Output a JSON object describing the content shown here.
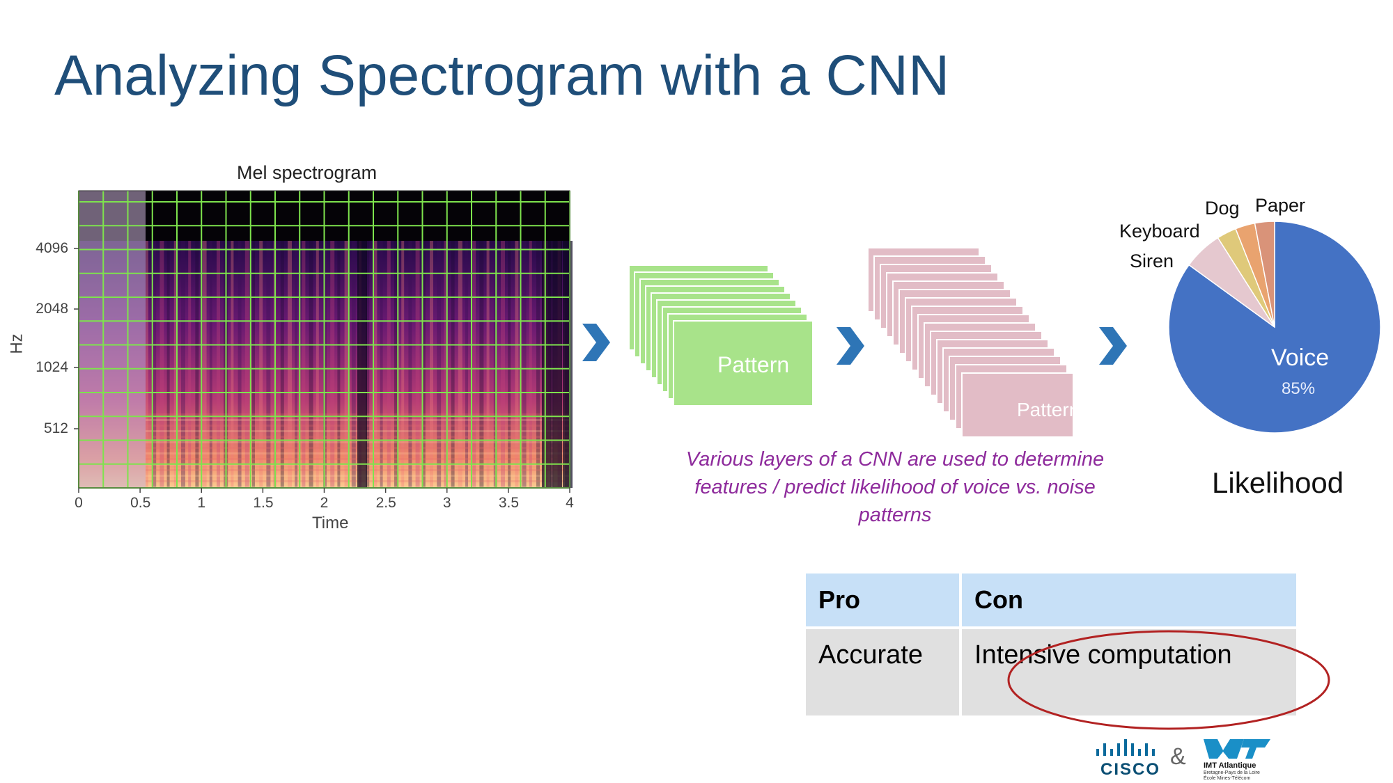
{
  "slide": {
    "title": "Analyzing Spectrogram with a CNN"
  },
  "spectrogram": {
    "title": "Mel spectrogram",
    "xlabel": "Time",
    "ylabel": "Hz",
    "xticks": [
      "0",
      "0.5",
      "1",
      "1.5",
      "2",
      "2.5",
      "3",
      "3.5",
      "4"
    ],
    "yticks": [
      "4096",
      "2048",
      "1024",
      "512"
    ],
    "grid_color": "#7ee34d"
  },
  "cnn": {
    "layer1_label": "Pattern",
    "layer2_label": "Pattern",
    "layer1_color": "#a8e38a",
    "layer2_color": "#e2bcc6",
    "arrow_color": "#2e75b6",
    "caption": "Various layers of a CNN are used to determine features / predict likelihood of voice vs. noise patterns"
  },
  "chart_data": {
    "type": "pie",
    "title": "",
    "slices": [
      {
        "label": "Voice",
        "value": 85,
        "value_label": "85%",
        "color": "#4472c4"
      },
      {
        "label": "Siren",
        "value": 6,
        "color": "#e5c8cf"
      },
      {
        "label": "Keyboard",
        "value": 3,
        "color": "#dfc97a"
      },
      {
        "label": "Dog",
        "value": 3,
        "color": "#e9a36f"
      },
      {
        "label": "Paper",
        "value": 3,
        "color": "#d99379"
      }
    ],
    "footer": "Likelihood"
  },
  "procon": {
    "headers": [
      "Pro",
      "Con"
    ],
    "row": [
      "Accurate",
      "Intensive computation"
    ],
    "highlight_color": "#b22222"
  },
  "logos": {
    "cisco": "CISCO",
    "amp": "&",
    "imt_name": "IMT Atlantique",
    "imt_line2": "Bretagne-Pays de la Loire",
    "imt_line3": "École Mines-Télécom"
  }
}
